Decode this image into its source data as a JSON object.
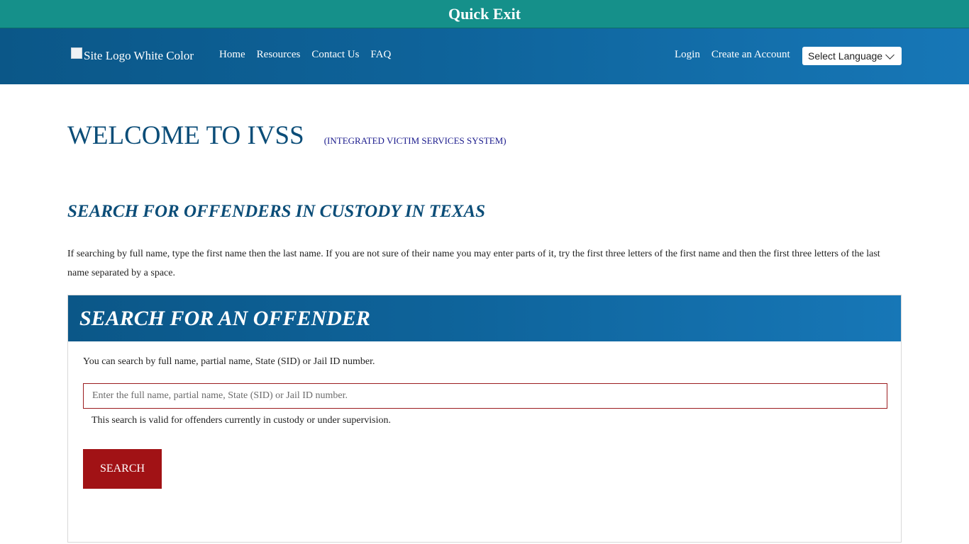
{
  "quick_exit": {
    "label": "Quick Exit"
  },
  "header": {
    "logo_alt": "Site Logo White Color",
    "nav_left": [
      {
        "label": "Home"
      },
      {
        "label": "Resources"
      },
      {
        "label": "Contact Us"
      },
      {
        "label": "FAQ"
      }
    ],
    "nav_right": [
      {
        "label": "Login"
      },
      {
        "label": "Create an Account"
      }
    ],
    "language_select": {
      "selected": "Select Language",
      "icon": "chevron-down-icon"
    }
  },
  "main": {
    "welcome_title": "WELCOME TO IVSS",
    "welcome_subtitle": "(INTEGRATED VICTIM SERVICES SYSTEM)",
    "section_title": "SEARCH FOR OFFENDERS IN CUSTODY IN TEXAS",
    "instructions": "If searching by full name, type the first name then the last name. If you are not sure of their name you may enter parts of it, try the first three letters of the first name and then the first three letters of the last name separated by a space.",
    "search_panel": {
      "title": "SEARCH FOR AN OFFENDER",
      "description": "You can search by full name, partial name, State (SID) or Jail ID number.",
      "input_value": "",
      "input_placeholder": "Enter the full name, partial name, State (SID) or Jail ID number.",
      "help_text": "This search is valid for offenders currently in custody or under supervision.",
      "button_label": "SEARCH"
    }
  },
  "colors": {
    "quick_exit_bg": "#15908a",
    "header_gradient_start": "#0b5788",
    "header_gradient_end": "#1777b7",
    "title_color": "#0b4d78",
    "button_bg": "#a11215",
    "input_border": "#9b1c1f"
  }
}
